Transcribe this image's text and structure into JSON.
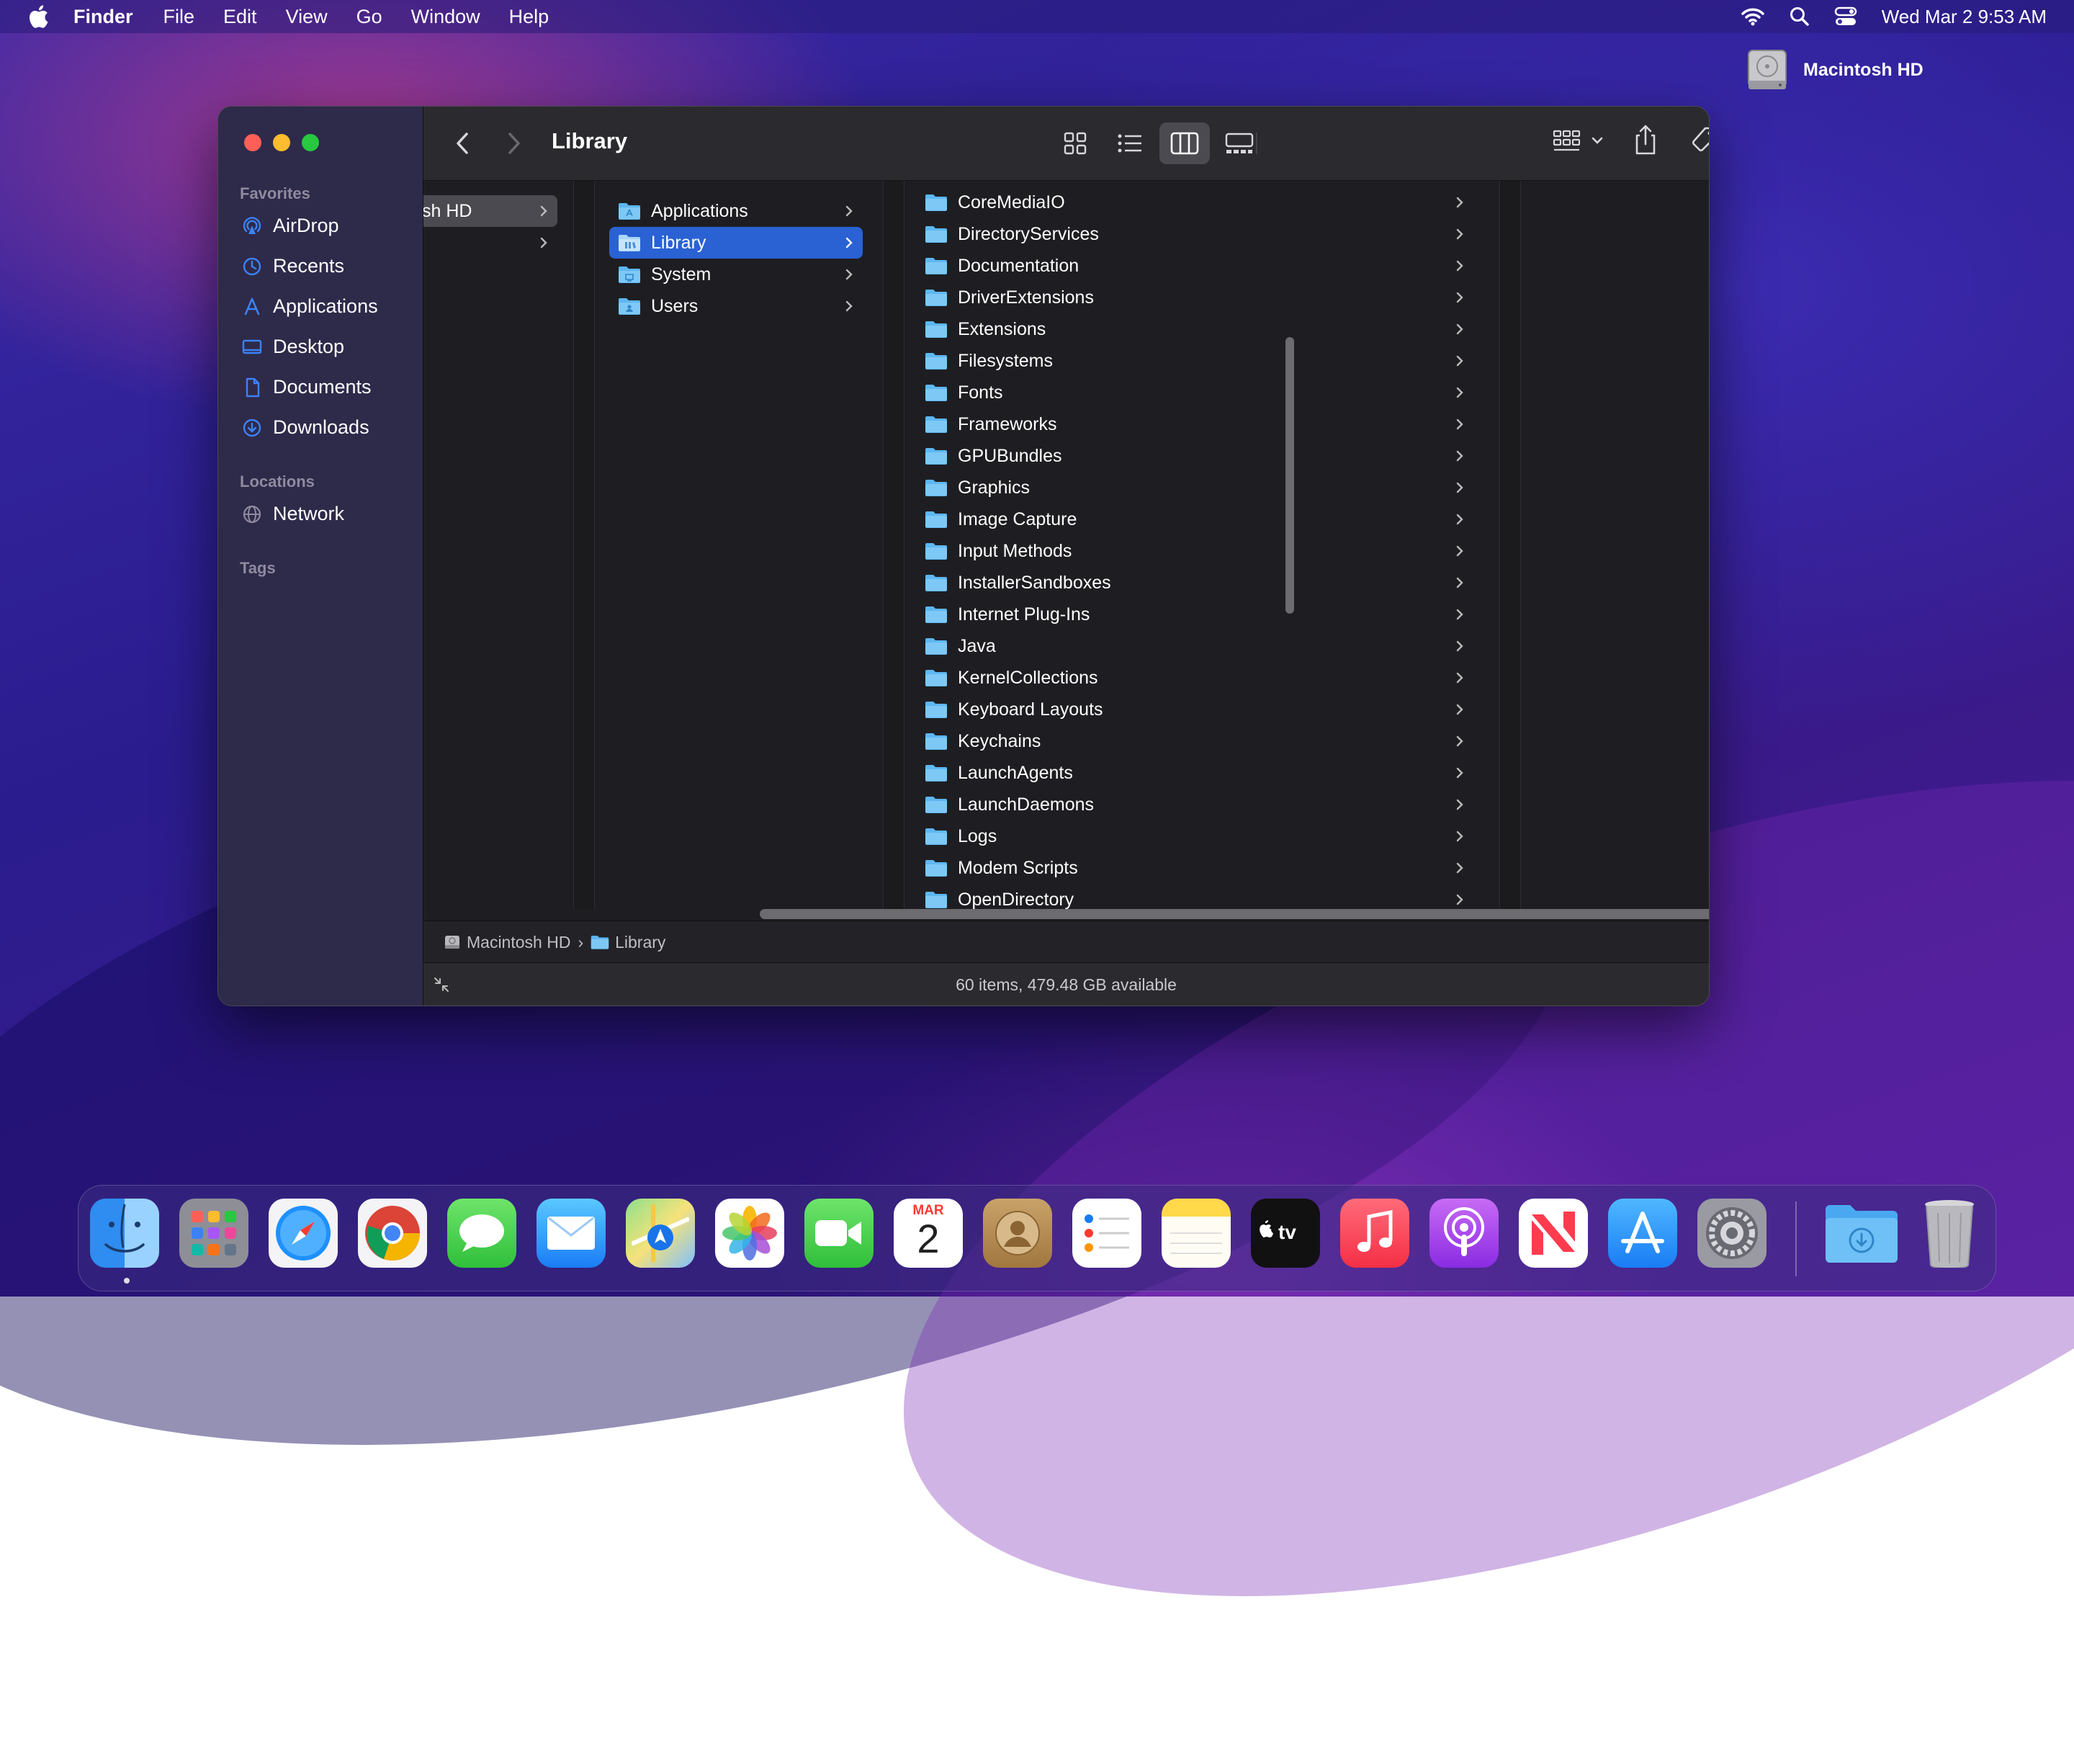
{
  "menubar": {
    "app_name": "Finder",
    "items": [
      "File",
      "Edit",
      "View",
      "Go",
      "Window",
      "Help"
    ],
    "clock": "Wed Mar 2  9:53 AM"
  },
  "desktop": {
    "drive_label": "Macintosh HD"
  },
  "window": {
    "title": "Library",
    "sidebar": {
      "favorites_header": "Favorites",
      "favorites": [
        {
          "label": "AirDrop",
          "icon": "airdrop-icon"
        },
        {
          "label": "Recents",
          "icon": "clock-icon"
        },
        {
          "label": "Applications",
          "icon": "applications-icon"
        },
        {
          "label": "Desktop",
          "icon": "desktop-icon"
        },
        {
          "label": "Documents",
          "icon": "document-icon"
        },
        {
          "label": "Downloads",
          "icon": "download-icon"
        }
      ],
      "locations_header": "Locations",
      "locations": [
        {
          "label": "Network",
          "icon": "globe-icon"
        }
      ],
      "tags_header": "Tags"
    },
    "columns": {
      "col0": [
        "sh HD"
      ],
      "col1": [
        "Applications",
        "Library",
        "System",
        "Users"
      ],
      "col1_selected": "Library",
      "col2": [
        "CoreMediaIO",
        "DirectoryServices",
        "Documentation",
        "DriverExtensions",
        "Extensions",
        "Filesystems",
        "Fonts",
        "Frameworks",
        "GPUBundles",
        "Graphics",
        "Image Capture",
        "Input Methods",
        "InstallerSandboxes",
        "Internet Plug-Ins",
        "Java",
        "KernelCollections",
        "Keyboard Layouts",
        "Keychains",
        "LaunchAgents",
        "LaunchDaemons",
        "Logs",
        "Modem Scripts",
        "OpenDirectory"
      ]
    },
    "pathbar": {
      "root": "Macintosh HD",
      "separator": "›",
      "current": "Library"
    },
    "status": "60 items, 479.48 GB available"
  },
  "colors": {
    "selection": "#2a62d4",
    "folder": "#5db7f2",
    "close": "#ff5f57",
    "minimize": "#febc2e",
    "zoom": "#28c840",
    "sidebar_icon": "#3b82f6"
  },
  "dock": {
    "calendar_month": "MAR",
    "calendar_day": "2",
    "apps": [
      "finder-icon",
      "launchpad-icon",
      "safari-icon",
      "chrome-icon",
      "messages-icon",
      "mail-icon",
      "maps-icon",
      "photos-icon",
      "facetime-icon",
      "calendar-icon",
      "contacts-icon",
      "reminders-icon",
      "notes-icon",
      "tv-icon",
      "music-icon",
      "podcasts-icon",
      "news-icon",
      "app-store-icon",
      "system-preferences-icon",
      "downloads-folder-icon",
      "trash-icon"
    ]
  }
}
